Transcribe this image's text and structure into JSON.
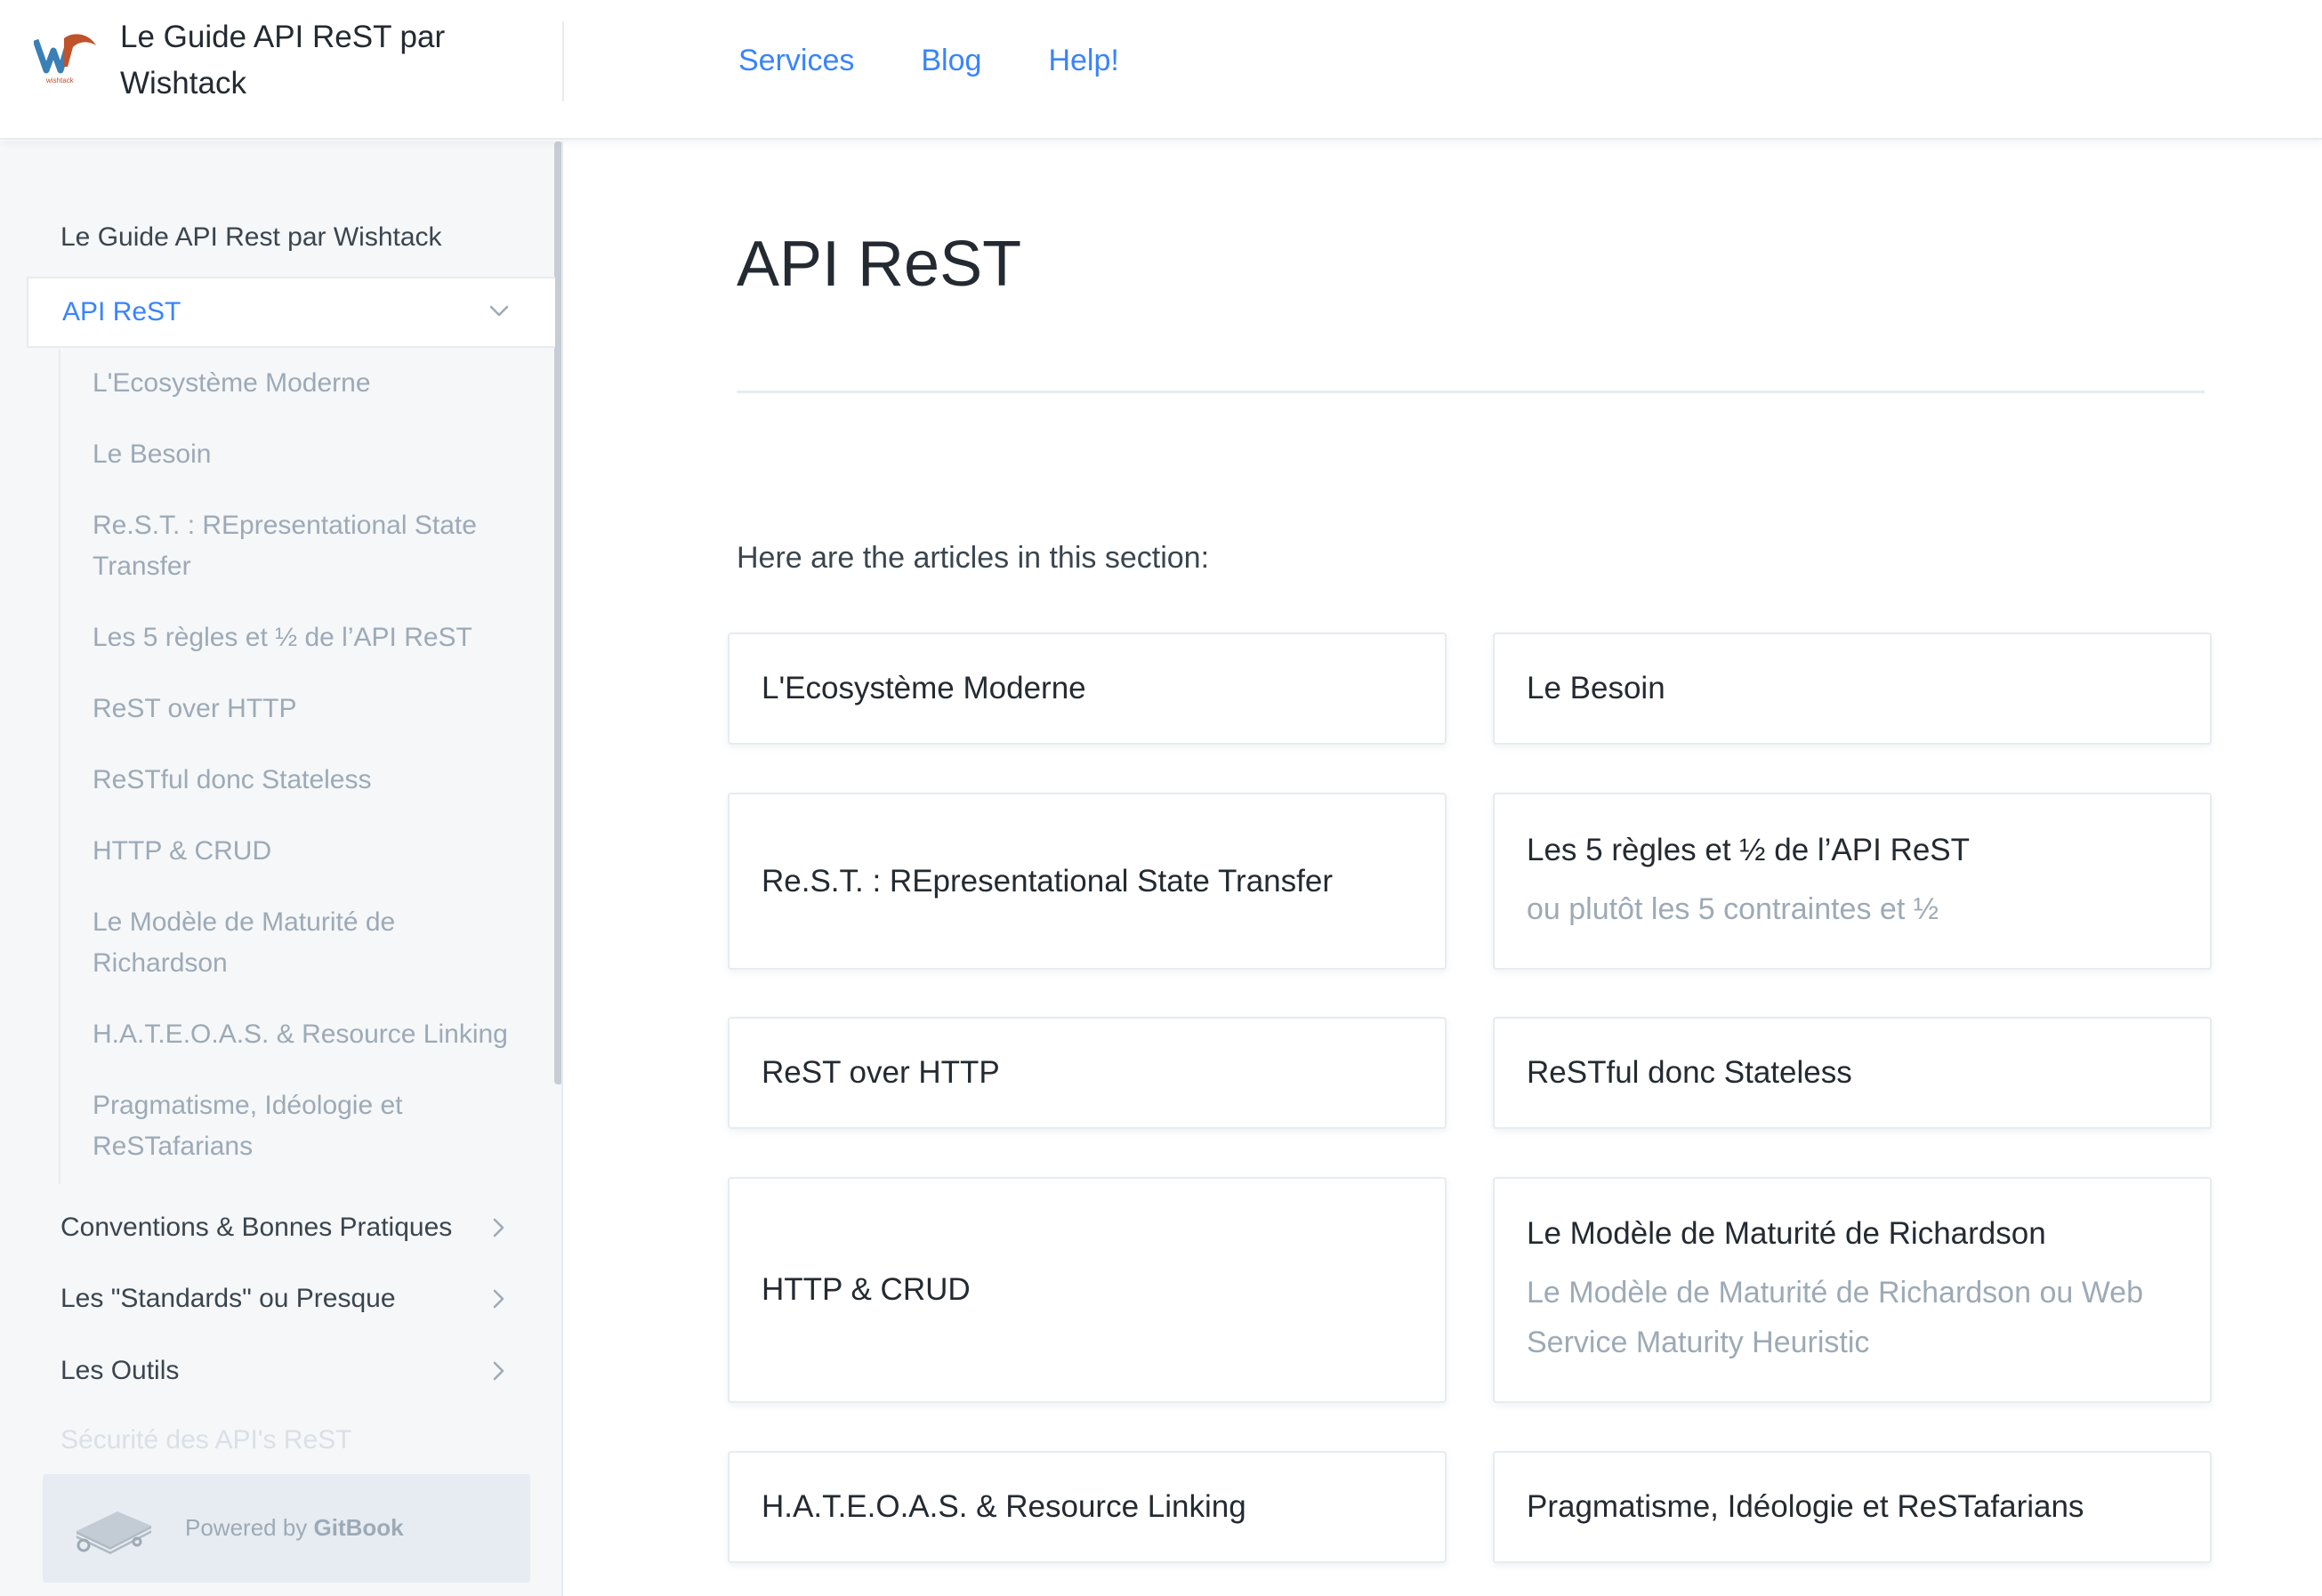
{
  "header": {
    "logo_text": "wishtack",
    "brand": "Le Guide API ReST par Wishtack",
    "nav": [
      "Services",
      "Blog",
      "Help!"
    ]
  },
  "sidebar": {
    "root_label": "Le Guide API Rest par Wishtack",
    "active_section": "API ReST",
    "sub_items": [
      "L'Ecosystème Moderne",
      "Le Besoin",
      "Re.S.T. : REpresentational State Transfer",
      "Les 5 règles et ½ de l’API ReST",
      "ReST over HTTP",
      "ReSTful donc Stateless",
      "HTTP & CRUD",
      "Le Modèle de Maturité de Richardson",
      "H.A.T.E.O.A.S. & Resource Linking",
      "Pragmatisme, Idéologie et ReSTafarians"
    ],
    "groups": [
      "Conventions & Bonnes Pratiques",
      "Les \"Standards\" ou Presque",
      "Les Outils"
    ],
    "faded_item": "Sécurité des API's ReST",
    "powered_prefix": "Powered by ",
    "powered_brand": "GitBook"
  },
  "main": {
    "title": "API ReST",
    "intro": "Here are the articles in this section:",
    "cards": [
      {
        "title": "L'Ecosystème Moderne",
        "description": ""
      },
      {
        "title": "Le Besoin",
        "description": ""
      },
      {
        "title": "Re.S.T. : REpresentational State Transfer",
        "description": ""
      },
      {
        "title": "Les 5 règles et ½ de l’API ReST",
        "description": "ou plutôt les 5 contraintes et ½"
      },
      {
        "title": "ReST over HTTP",
        "description": ""
      },
      {
        "title": "ReSTful donc Stateless",
        "description": ""
      },
      {
        "title": "HTTP & CRUD",
        "description": ""
      },
      {
        "title": "Le Modèle de Maturité de Richardson",
        "description": "Le Modèle de Maturité de Richardson ou Web Service Maturity Heuristic"
      },
      {
        "title": "H.A.T.E.O.A.S. & Resource Linking",
        "description": ""
      },
      {
        "title": "Pragmatisme, Idéologie et ReSTafarians",
        "description": ""
      }
    ]
  },
  "colors": {
    "accent": "#3884ff",
    "text": "#242a31",
    "muted": "#9daab6",
    "sidebar_bg": "#f5f7f9",
    "border": "#e6ecf1"
  }
}
